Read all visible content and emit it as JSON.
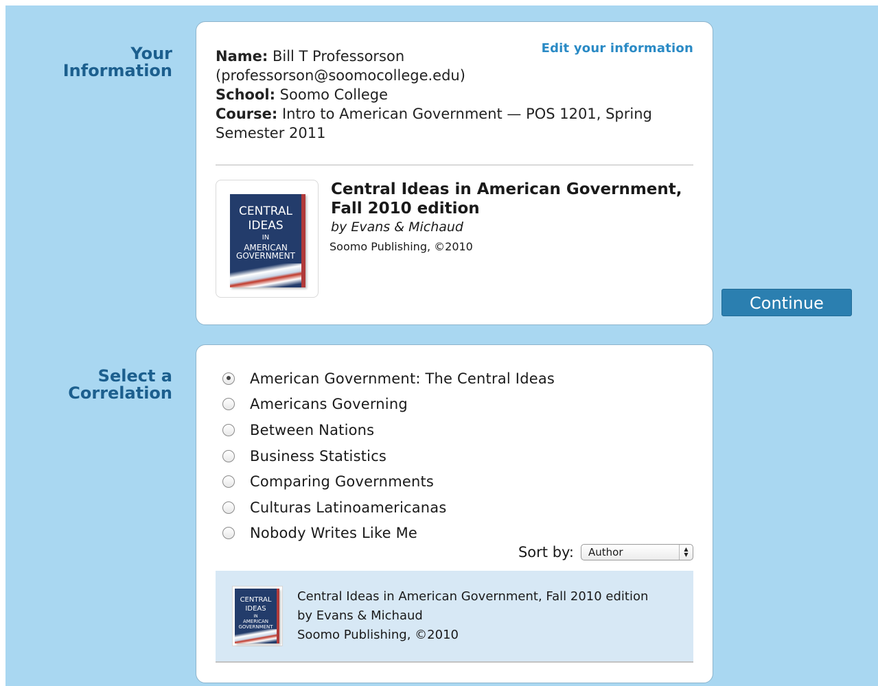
{
  "your_information": {
    "label_line1": "Your",
    "label_line2": "Information",
    "edit_link": "Edit your information",
    "name_label": "Name:",
    "name_value": "Bill T Professorson",
    "email": "(professorson@soomocollege.edu)",
    "school_label": "School:",
    "school_value": "Soomo College",
    "course_label": "Course:",
    "course_value": "Intro to American Government — POS 1201, Spring Semester 2011",
    "book": {
      "title": "Central Ideas in American Government, Fall 2010 edition",
      "author": "by Evans & Michaud",
      "publisher": "Soomo Publishing, ©2010",
      "cover_line1": "CENTRAL",
      "cover_line2": "IDEAS",
      "cover_line3": "IN",
      "cover_line4": "AMERICAN",
      "cover_line5": "GOVERNMENT"
    }
  },
  "continue_button": "Continue",
  "correlation": {
    "label_line1": "Select a",
    "label_line2": "Correlation",
    "options": [
      "American Government: The Central Ideas",
      "Americans Governing",
      "Between Nations",
      "Business Statistics",
      "Comparing Governments",
      "Culturas Latinoamericanas",
      "Nobody Writes Like Me"
    ],
    "selected_option": "American Government: The Central Ideas",
    "sort_label": "Sort by:",
    "sort_value": "Author",
    "preview": {
      "title": "Central Ideas in American Government, Fall 2010 edition",
      "author": "by Evans & Michaud",
      "publisher": "Soomo Publishing, ©2010"
    }
  },
  "colors": {
    "background": "#a9d7f1",
    "heading": "#1c5f8e",
    "link": "#2a8ac5",
    "button": "#2b7fb0",
    "preview_bg": "#d7e8f5"
  }
}
